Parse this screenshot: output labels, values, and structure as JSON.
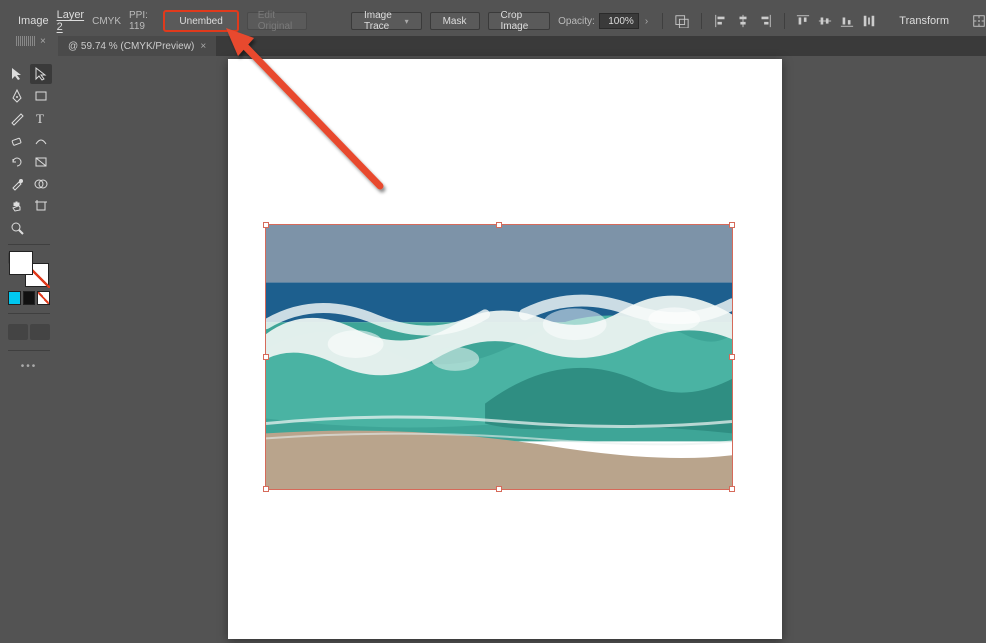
{
  "controlbar": {
    "image_label": "Image",
    "layer_link": "Layer 2",
    "color_mode": "CMYK",
    "ppi_label": "PPI:",
    "ppi_value": "119",
    "unembed": "Unembed",
    "edit_original": "Edit Original",
    "image_trace": "Image Trace",
    "mask": "Mask",
    "crop": "Crop Image",
    "opacity_label": "Opacity:",
    "opacity_value": "100%",
    "transform": "Transform"
  },
  "tab": {
    "title": "@ 59.74 % (CMYK/Preview)"
  },
  "align_icons": [
    "align-left",
    "align-center-h",
    "align-right",
    "align-top",
    "align-center-v",
    "align-bottom"
  ]
}
